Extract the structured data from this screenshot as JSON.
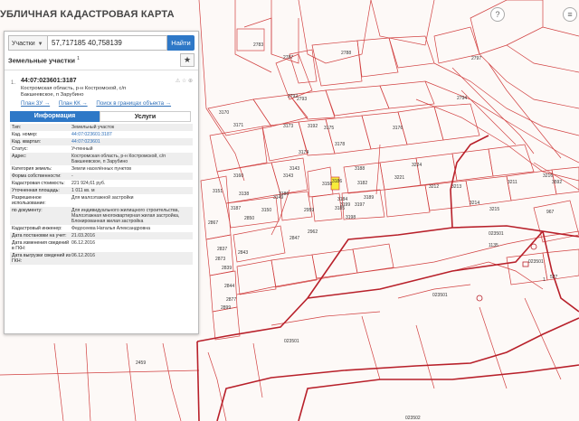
{
  "app": {
    "title": "УБЛИЧНАЯ КАДАСТРОВАЯ КАРТА"
  },
  "search": {
    "type": "Участки",
    "value": "57,717185 40,758139",
    "button": "Найти"
  },
  "section": {
    "title": "Земельные участки",
    "count": "1"
  },
  "result": {
    "num": "1.",
    "title": "44:07:023601:3187",
    "address": "Костромская область, р-н Костромской, с/п Бакшеевское, п Зарубино",
    "links": [
      "План ЗУ →",
      "План КК →",
      "Поиск в границах объекта →"
    ]
  },
  "tabs": [
    {
      "label": "Информация"
    },
    {
      "label": "Услуги"
    }
  ],
  "rows": [
    {
      "label": "Тип:",
      "value": "Земельный участок"
    },
    {
      "label": "Кад. номер:",
      "value": "44:07:023601:3187",
      "link": true
    },
    {
      "label": "Кад. квартал:",
      "value": "44:07:023601",
      "link": true
    },
    {
      "label": "Статус:",
      "value": "Учтенный"
    },
    {
      "label": "Адрес:",
      "value": "Костромская область, р-н Костромской, с/п Бакшеевское, п Зарубино"
    },
    {
      "label": "Категория земель:",
      "value": "Земли населённых пунктов"
    },
    {
      "label": "Форма собственности:",
      "value": "-"
    },
    {
      "label": "Кадастровая стоимость:",
      "value": "221 924,61 руб."
    },
    {
      "label": "Уточненная площадь:",
      "value": "1 011 кв. м"
    },
    {
      "label": "Разрешенное использование:",
      "value": "Для малоэтажной застройки"
    },
    {
      "label": "по документу:",
      "value": "Для индивидуального жилищного строительства, Малоэтажная многоквартирная жилая застройка, Блокированная жилая застройка"
    },
    {
      "label": "Кадастровый инженер:",
      "value": "Федосеева Наталья Александровна"
    },
    {
      "label": "Дата постановки на учет:",
      "value": "21.03.2016"
    },
    {
      "label": "Дата изменения сведений в ГКН:",
      "value": "06.12.2016"
    },
    {
      "label": "Дата выгрузки сведений из ГКН:",
      "value": "06.12.2016"
    }
  ],
  "map_labels": [
    "2783",
    "2787",
    "2788",
    "2792",
    "2793",
    "2797",
    "2794",
    "3170",
    "3171",
    "3173",
    "3174",
    "3175",
    "3176",
    "3178",
    "3188",
    "3189",
    "3192",
    "3224",
    "3221",
    "3212",
    "3213",
    "3214",
    "3215",
    "3216",
    "3211",
    "3138",
    "3143",
    "3149",
    "3150",
    "3151",
    "3158",
    "3184",
    "3185",
    "3186",
    "3187",
    "2959",
    "2962",
    "2837",
    "2839",
    "2843",
    "2844",
    "2847",
    "2850",
    "2867",
    "2873",
    "2877",
    "2899",
    "2459",
    "023501",
    "023501",
    "023501",
    "023501",
    "023502",
    "527",
    "967",
    "1",
    "3186",
    "3592",
    "1135",
    "3199",
    "3197",
    "3198",
    "3182",
    "3143",
    "3160"
  ],
  "colors": {
    "parcel_line": "#d14040",
    "parcel_line_bold": "#b8202a",
    "selected_parcel": "#f7ec3a",
    "accent": "#2e78c7"
  }
}
